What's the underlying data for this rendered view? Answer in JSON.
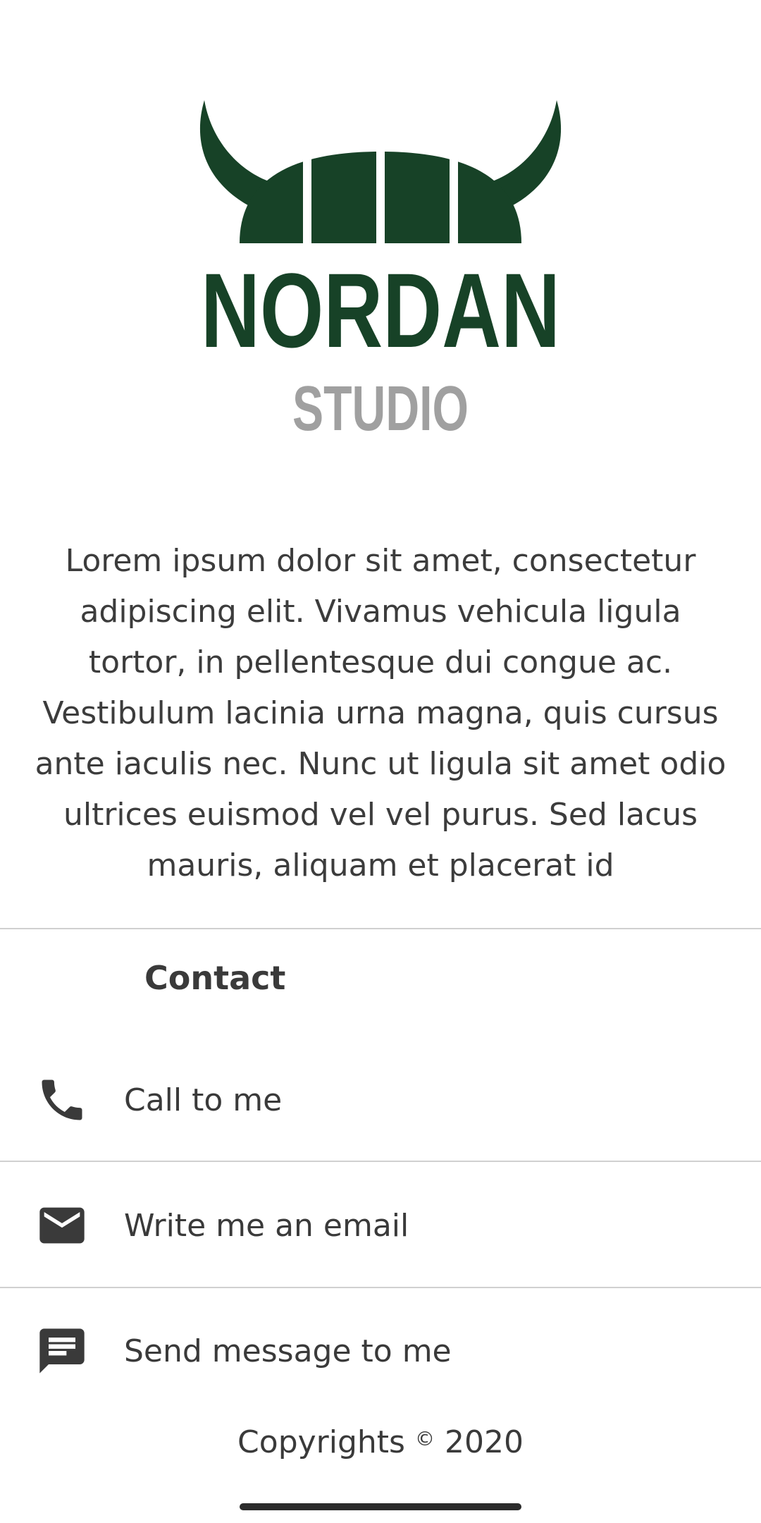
{
  "logo": {
    "name": "NORDAN",
    "subtitle": "STUDIO",
    "color_primary": "#174227",
    "color_secondary": "#a0a0a0"
  },
  "description": "Lorem ipsum dolor sit amet, consectetur adipiscing elit. Vivamus vehicula ligula tortor, in pellentesque dui congue ac. Vestibulum lacinia urna magna, quis cursus ante iaculis nec. Nunc ut ligula sit amet odio ultrices euismod vel vel purus. Sed lacus mauris, aliquam et placerat id",
  "contact": {
    "title": "Contact",
    "items": [
      {
        "label": "Call to me",
        "icon": "phone-icon"
      },
      {
        "label": "Write me an email",
        "icon": "email-icon"
      },
      {
        "label": "Send message to me",
        "icon": "message-icon"
      }
    ]
  },
  "footer": {
    "text": "Copyrights",
    "symbol": "©",
    "year": "2020"
  }
}
